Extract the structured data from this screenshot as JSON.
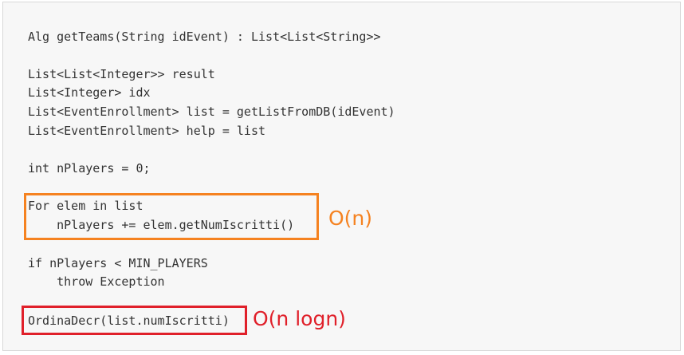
{
  "code": {
    "lines": [
      "Alg getTeams(String idEvent) : List<List<String>>",
      "List<List<Integer>> result",
      "List<Integer> idx",
      "List<EventEnrollment> list = getListFromDB(idEvent)",
      "List<EventEnrollment> help = list",
      "int nPlayers = 0;",
      "For elem in list",
      "    nPlayers += elem.getNumIscritti()",
      "if nPlayers < MIN_PLAYERS",
      "    throw Exception",
      "OrdinaDecr(list.numIscritti)"
    ]
  },
  "annotations": {
    "loop_complexity": "O(n)",
    "sort_complexity": "O(n logn)"
  },
  "colors": {
    "panel_background": "#f7f7f7",
    "code_text": "#333333",
    "loop_highlight": "#f58220",
    "sort_highlight": "#e0202a"
  }
}
